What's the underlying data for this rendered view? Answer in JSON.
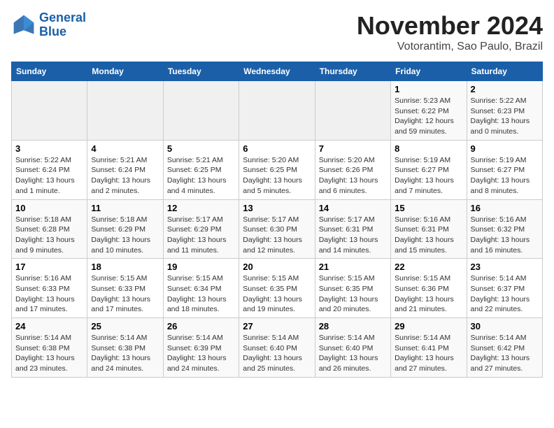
{
  "logo": {
    "line1": "General",
    "line2": "Blue"
  },
  "title": "November 2024",
  "location": "Votorantim, Sao Paulo, Brazil",
  "days_of_week": [
    "Sunday",
    "Monday",
    "Tuesday",
    "Wednesday",
    "Thursday",
    "Friday",
    "Saturday"
  ],
  "weeks": [
    [
      {
        "day": "",
        "info": ""
      },
      {
        "day": "",
        "info": ""
      },
      {
        "day": "",
        "info": ""
      },
      {
        "day": "",
        "info": ""
      },
      {
        "day": "",
        "info": ""
      },
      {
        "day": "1",
        "info": "Sunrise: 5:23 AM\nSunset: 6:22 PM\nDaylight: 12 hours and 59 minutes."
      },
      {
        "day": "2",
        "info": "Sunrise: 5:22 AM\nSunset: 6:23 PM\nDaylight: 13 hours and 0 minutes."
      }
    ],
    [
      {
        "day": "3",
        "info": "Sunrise: 5:22 AM\nSunset: 6:24 PM\nDaylight: 13 hours and 1 minute."
      },
      {
        "day": "4",
        "info": "Sunrise: 5:21 AM\nSunset: 6:24 PM\nDaylight: 13 hours and 2 minutes."
      },
      {
        "day": "5",
        "info": "Sunrise: 5:21 AM\nSunset: 6:25 PM\nDaylight: 13 hours and 4 minutes."
      },
      {
        "day": "6",
        "info": "Sunrise: 5:20 AM\nSunset: 6:25 PM\nDaylight: 13 hours and 5 minutes."
      },
      {
        "day": "7",
        "info": "Sunrise: 5:20 AM\nSunset: 6:26 PM\nDaylight: 13 hours and 6 minutes."
      },
      {
        "day": "8",
        "info": "Sunrise: 5:19 AM\nSunset: 6:27 PM\nDaylight: 13 hours and 7 minutes."
      },
      {
        "day": "9",
        "info": "Sunrise: 5:19 AM\nSunset: 6:27 PM\nDaylight: 13 hours and 8 minutes."
      }
    ],
    [
      {
        "day": "10",
        "info": "Sunrise: 5:18 AM\nSunset: 6:28 PM\nDaylight: 13 hours and 9 minutes."
      },
      {
        "day": "11",
        "info": "Sunrise: 5:18 AM\nSunset: 6:29 PM\nDaylight: 13 hours and 10 minutes."
      },
      {
        "day": "12",
        "info": "Sunrise: 5:17 AM\nSunset: 6:29 PM\nDaylight: 13 hours and 11 minutes."
      },
      {
        "day": "13",
        "info": "Sunrise: 5:17 AM\nSunset: 6:30 PM\nDaylight: 13 hours and 12 minutes."
      },
      {
        "day": "14",
        "info": "Sunrise: 5:17 AM\nSunset: 6:31 PM\nDaylight: 13 hours and 14 minutes."
      },
      {
        "day": "15",
        "info": "Sunrise: 5:16 AM\nSunset: 6:31 PM\nDaylight: 13 hours and 15 minutes."
      },
      {
        "day": "16",
        "info": "Sunrise: 5:16 AM\nSunset: 6:32 PM\nDaylight: 13 hours and 16 minutes."
      }
    ],
    [
      {
        "day": "17",
        "info": "Sunrise: 5:16 AM\nSunset: 6:33 PM\nDaylight: 13 hours and 17 minutes."
      },
      {
        "day": "18",
        "info": "Sunrise: 5:15 AM\nSunset: 6:33 PM\nDaylight: 13 hours and 17 minutes."
      },
      {
        "day": "19",
        "info": "Sunrise: 5:15 AM\nSunset: 6:34 PM\nDaylight: 13 hours and 18 minutes."
      },
      {
        "day": "20",
        "info": "Sunrise: 5:15 AM\nSunset: 6:35 PM\nDaylight: 13 hours and 19 minutes."
      },
      {
        "day": "21",
        "info": "Sunrise: 5:15 AM\nSunset: 6:35 PM\nDaylight: 13 hours and 20 minutes."
      },
      {
        "day": "22",
        "info": "Sunrise: 5:15 AM\nSunset: 6:36 PM\nDaylight: 13 hours and 21 minutes."
      },
      {
        "day": "23",
        "info": "Sunrise: 5:14 AM\nSunset: 6:37 PM\nDaylight: 13 hours and 22 minutes."
      }
    ],
    [
      {
        "day": "24",
        "info": "Sunrise: 5:14 AM\nSunset: 6:38 PM\nDaylight: 13 hours and 23 minutes."
      },
      {
        "day": "25",
        "info": "Sunrise: 5:14 AM\nSunset: 6:38 PM\nDaylight: 13 hours and 24 minutes."
      },
      {
        "day": "26",
        "info": "Sunrise: 5:14 AM\nSunset: 6:39 PM\nDaylight: 13 hours and 24 minutes."
      },
      {
        "day": "27",
        "info": "Sunrise: 5:14 AM\nSunset: 6:40 PM\nDaylight: 13 hours and 25 minutes."
      },
      {
        "day": "28",
        "info": "Sunrise: 5:14 AM\nSunset: 6:40 PM\nDaylight: 13 hours and 26 minutes."
      },
      {
        "day": "29",
        "info": "Sunrise: 5:14 AM\nSunset: 6:41 PM\nDaylight: 13 hours and 27 minutes."
      },
      {
        "day": "30",
        "info": "Sunrise: 5:14 AM\nSunset: 6:42 PM\nDaylight: 13 hours and 27 minutes."
      }
    ]
  ]
}
